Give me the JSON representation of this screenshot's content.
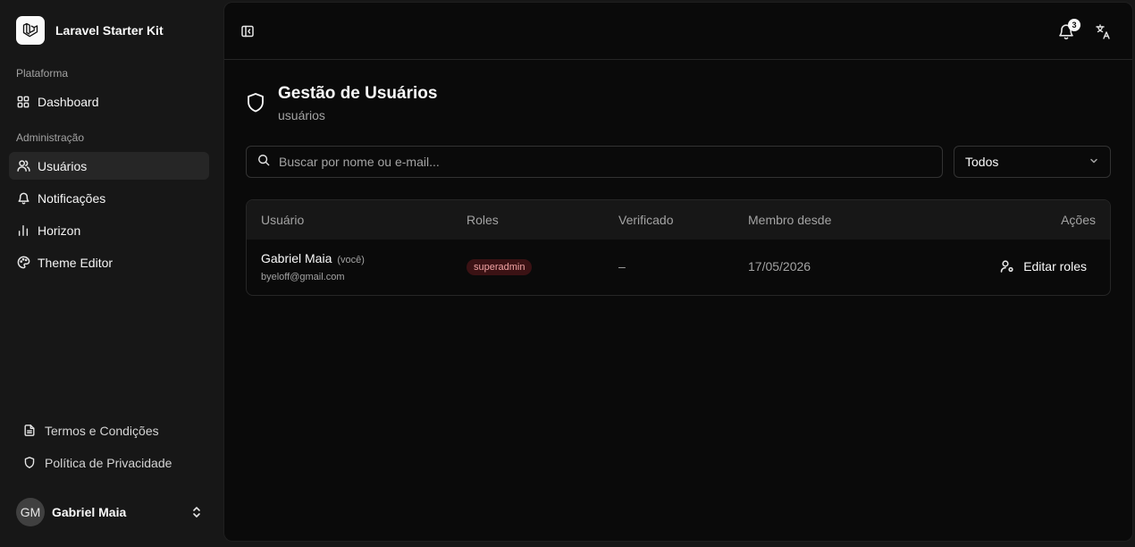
{
  "app": {
    "name": "Laravel Starter Kit"
  },
  "sidebar": {
    "group_platform": "Plataforma",
    "group_admin": "Administração",
    "items": [
      {
        "label": "Dashboard",
        "icon": "grid-icon"
      },
      {
        "label": "Usuários",
        "icon": "users-icon",
        "active": true
      },
      {
        "label": "Notificações",
        "icon": "bell-icon"
      },
      {
        "label": "Horizon",
        "icon": "bar-chart-icon"
      },
      {
        "label": "Theme Editor",
        "icon": "palette-icon"
      }
    ],
    "footer_links": [
      {
        "label": "Termos e Condições",
        "icon": "file-text-icon"
      },
      {
        "label": "Política de Privacidade",
        "icon": "shield-icon"
      }
    ],
    "user": {
      "initials": "GM",
      "name": "Gabriel Maia"
    }
  },
  "topbar": {
    "notification_count": "3"
  },
  "page": {
    "title": "Gestão de Usuários",
    "subtitle": "usuários"
  },
  "search": {
    "placeholder": "Buscar por nome ou e-mail...",
    "value": ""
  },
  "filter": {
    "selected": "Todos"
  },
  "table": {
    "headers": {
      "user": "Usuário",
      "roles": "Roles",
      "verified": "Verificado",
      "member_since": "Membro desde",
      "actions": "Ações"
    },
    "rows": [
      {
        "name": "Gabriel Maia",
        "you": "(você)",
        "email": "byeloff@gmail.com",
        "role": "superadmin",
        "verified": "–",
        "member_since": "17/05/2026",
        "action_label": "Editar roles"
      }
    ]
  },
  "colors": {
    "background": "#0a0a0a",
    "sidebar": "#171717",
    "role_badge_bg": "#3b1214",
    "role_badge_text": "#f0a3a3"
  }
}
